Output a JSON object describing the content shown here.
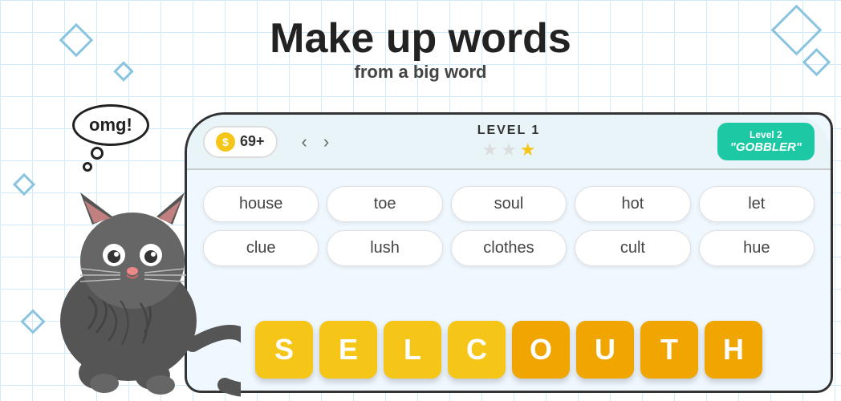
{
  "page": {
    "title": "Make up words",
    "subtitle": "from a big word"
  },
  "speech": {
    "text": "omg!"
  },
  "topbar": {
    "coins": "69+",
    "level_label": "LEVEL 1",
    "stars": [
      false,
      false,
      true
    ],
    "nav_left": "‹",
    "nav_right": "›",
    "next_level_line1": "Level 2",
    "next_level_line2": "\"GOBBLER\""
  },
  "words": [
    {
      "text": "house",
      "row": 1,
      "col": 1
    },
    {
      "text": "toe",
      "row": 1,
      "col": 2
    },
    {
      "text": "soul",
      "row": 1,
      "col": 3
    },
    {
      "text": "hot",
      "row": 1,
      "col": 4
    },
    {
      "text": "let",
      "row": 1,
      "col": 5
    },
    {
      "text": "clue",
      "row": 2,
      "col": 1
    },
    {
      "text": "lush",
      "row": 2,
      "col": 2
    },
    {
      "text": "clothes",
      "row": 2,
      "col": 3
    },
    {
      "text": "cult",
      "row": 2,
      "col": 4
    },
    {
      "text": "hue",
      "row": 2,
      "col": 5
    }
  ],
  "tiles": [
    {
      "letter": "S",
      "type": "yellow"
    },
    {
      "letter": "E",
      "type": "yellow"
    },
    {
      "letter": "L",
      "type": "yellow"
    },
    {
      "letter": "C",
      "type": "yellow"
    },
    {
      "letter": "O",
      "type": "orange"
    },
    {
      "letter": "U",
      "type": "orange"
    },
    {
      "letter": "T",
      "type": "orange"
    },
    {
      "letter": "H",
      "type": "orange"
    }
  ],
  "decorations": {
    "diamond_color": "#7bbfd4"
  }
}
